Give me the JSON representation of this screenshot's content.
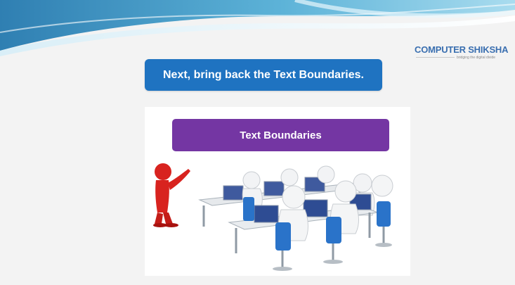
{
  "slide": {
    "instruction": "Next, bring back the Text Boundaries.",
    "label_button": "Text Boundaries"
  },
  "logo": {
    "name": "COMPUTER SHIKSHA",
    "tagline": "bridging the digital divide"
  },
  "illustration": {
    "description_icon": "classroom-presenter-icon"
  },
  "colors": {
    "instruction_bg": "#1f73c1",
    "label_bg": "#7436a3",
    "wave_dark": "#2a7fb5",
    "wave_light": "#bfe4f2"
  }
}
